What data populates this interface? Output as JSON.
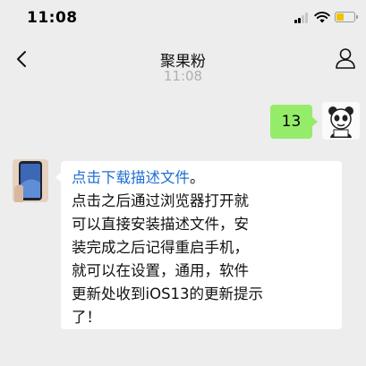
{
  "status_bar": {
    "time": "11:08"
  },
  "nav": {
    "title": "聚果粉"
  },
  "timestamp": "11:08",
  "messages": {
    "self": {
      "text": "13"
    },
    "other": {
      "link_text": "点击下载描述文件",
      "link_suffix": "。",
      "lines": [
        "点击之后通过浏览器打开就",
        "可以直接安装描述文件，安",
        "装完成之后记得重启手机，",
        "就可以在设置，通用，软件",
        "更新处收到iOS13的更新提示",
        "了！"
      ]
    }
  },
  "icons": {
    "back": "chevron-left-icon",
    "profile": "person-icon",
    "signal": "signal-icon",
    "wifi": "wifi-icon",
    "battery": "battery-icon"
  },
  "colors": {
    "background": "#ededed",
    "self_bubble": "#95ec69",
    "link": "#1f6fd1",
    "battery": "#f2c200"
  }
}
